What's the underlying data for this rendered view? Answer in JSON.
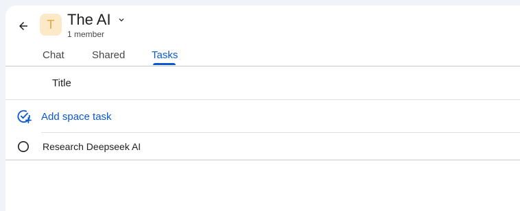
{
  "header": {
    "avatar_letter": "T",
    "space_name": "The AI",
    "member_count": "1 member"
  },
  "tabs": [
    {
      "label": "Chat"
    },
    {
      "label": "Shared"
    },
    {
      "label": "Tasks",
      "active": true
    }
  ],
  "task_list": {
    "column_title": "Title",
    "add_task_label": "Add space task",
    "tasks": [
      {
        "title": "Research Deepseek AI",
        "completed": false
      }
    ]
  },
  "colors": {
    "accent": "#0b57d0",
    "avatar_bg": "#fbe9c7",
    "avatar_fg": "#e8a43a"
  }
}
